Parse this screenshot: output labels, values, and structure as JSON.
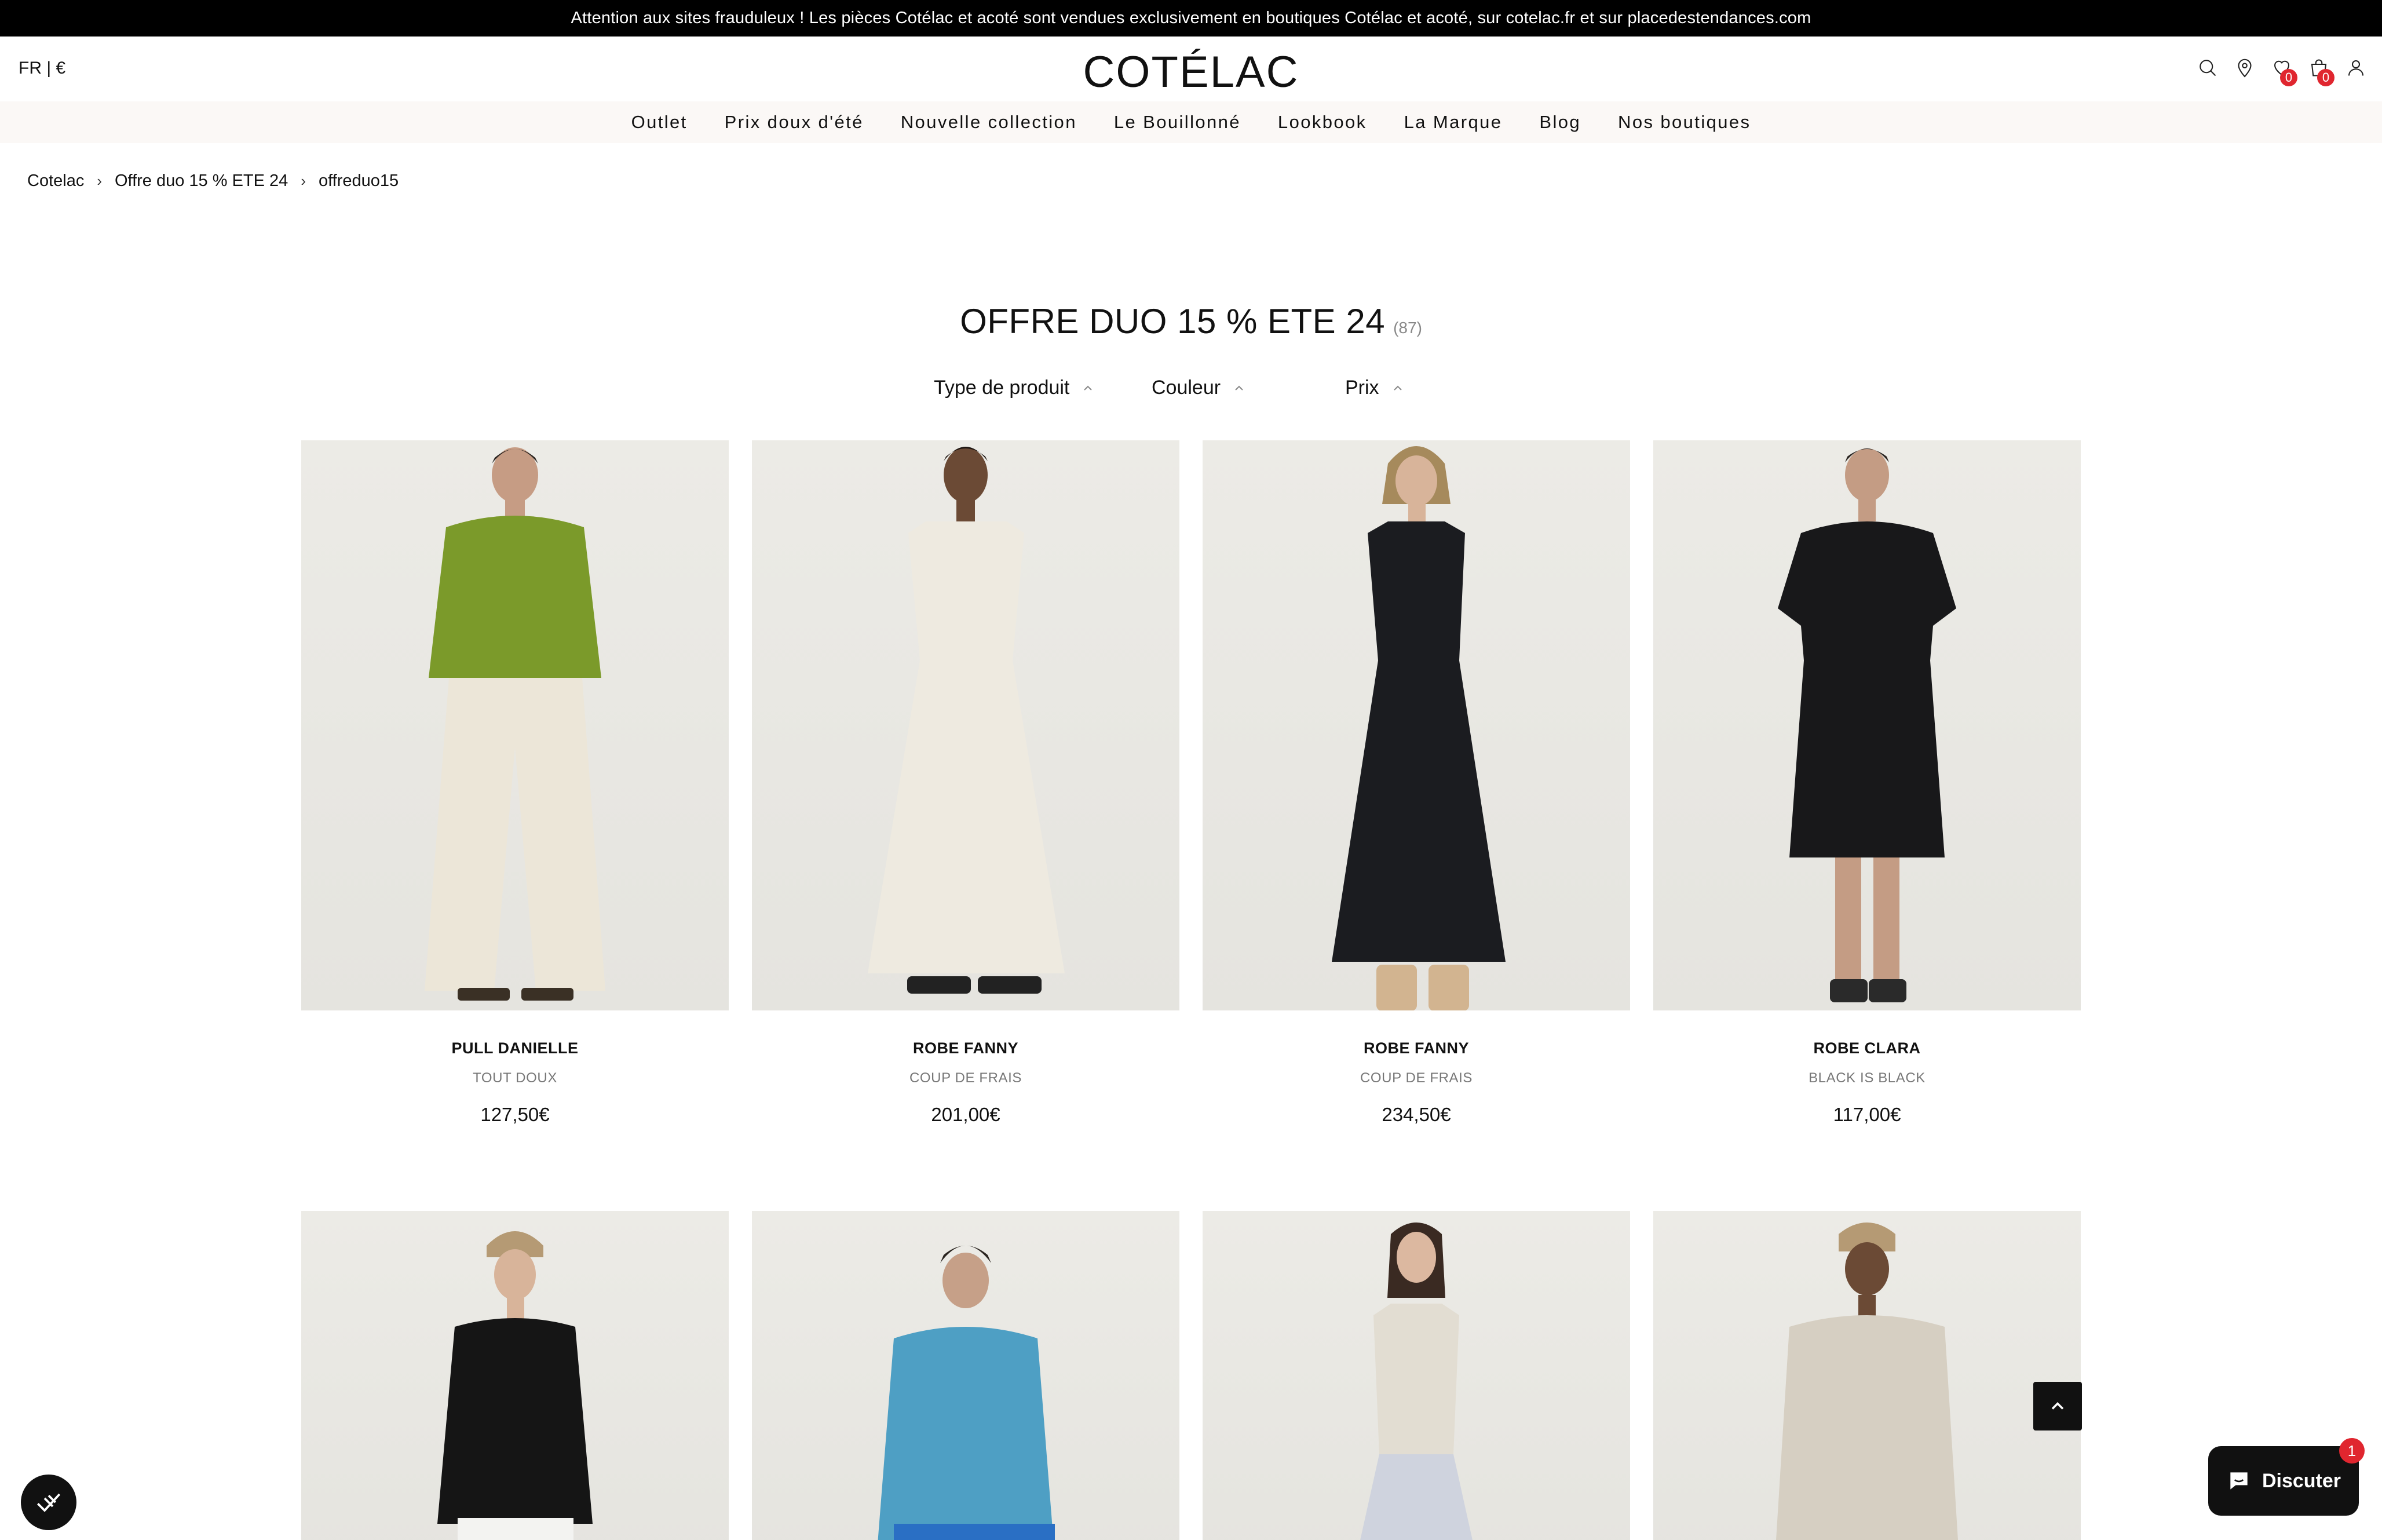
{
  "announcement": "Attention aux sites frauduleux ! Les pièces Cotélac et acoté sont vendues exclusivement en boutiques Cotélac et acoté, sur cotelac.fr et sur placedestendances.com",
  "header": {
    "locale": "FR | €",
    "logo": "COTÉLAC",
    "wishlist_count": "0",
    "cart_count": "0",
    "icons": [
      "search-icon",
      "location-pin-icon",
      "heart-icon",
      "bag-icon",
      "user-icon"
    ]
  },
  "nav": [
    "Outlet",
    "Prix doux d'été",
    "Nouvelle collection",
    "Le Bouillonné",
    "Lookbook",
    "La Marque",
    "Blog",
    "Nos boutiques"
  ],
  "breadcrumb": [
    "Cotelac",
    "Offre duo 15 % ETE 24",
    "offreduo15"
  ],
  "collection": {
    "title": "OFFRE DUO 15 % ETE 24",
    "count": "(87)"
  },
  "filters": [
    "Type de produit",
    "Couleur",
    "Prix"
  ],
  "products": [
    {
      "name": "PULL DANIELLE",
      "brand": "TOUT DOUX",
      "price": "127,50€",
      "top": "#7b9a2a",
      "bottom": "#ece6d8"
    },
    {
      "name": "ROBE FANNY",
      "brand": "COUP DE FRAIS",
      "price": "201,00€",
      "top": "#eeeae0",
      "bottom": "#eeeae0"
    },
    {
      "name": "ROBE FANNY",
      "brand": "COUP DE FRAIS",
      "price": "234,50€",
      "top": "#1b1c20",
      "bottom": "#1b1c20"
    },
    {
      "name": "ROBE CLARA",
      "brand": "BLACK IS BLACK",
      "price": "117,00€",
      "top": "#18181a",
      "bottom": "#18181a"
    }
  ],
  "products_row2": [
    {
      "top": "#151515",
      "bottom": "#f3f3f1"
    },
    {
      "top": "#4e9fc4",
      "bottom": "#2a6fc4"
    },
    {
      "top": "#e2ddd2",
      "bottom": "#cfd3de"
    },
    {
      "top": "#d6cfc2",
      "bottom": "#d6cfc2"
    }
  ],
  "chat": {
    "label": "Discuter",
    "badge": "1"
  }
}
